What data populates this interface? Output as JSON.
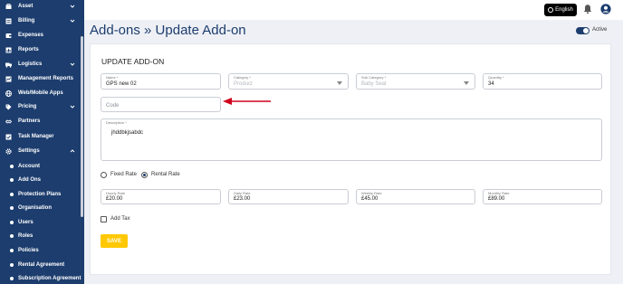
{
  "sidebar": {
    "items": [
      {
        "label": "Asset",
        "icon": "asset-icon",
        "chevron": "down"
      },
      {
        "label": "Billing",
        "icon": "billing-icon",
        "chevron": "down"
      },
      {
        "label": "Expenses",
        "icon": "expenses-icon"
      },
      {
        "label": "Reports",
        "icon": "reports-icon"
      },
      {
        "label": "Logistics",
        "icon": "logistics-icon",
        "chevron": "down"
      },
      {
        "label": "Management Reports",
        "icon": "management-reports-icon"
      },
      {
        "label": "Web/Mobile Apps",
        "icon": "globe-icon"
      },
      {
        "label": "Pricing",
        "icon": "tag-icon",
        "chevron": "down"
      },
      {
        "label": "Partners",
        "icon": "handshake-icon"
      },
      {
        "label": "Task Manager",
        "icon": "task-icon"
      },
      {
        "label": "Settings",
        "icon": "gear-icon",
        "chevron": "up"
      }
    ],
    "subitems": [
      {
        "label": "Account"
      },
      {
        "label": "Add Ons"
      },
      {
        "label": "Protection Plans"
      },
      {
        "label": "Organisation"
      },
      {
        "label": "Users"
      },
      {
        "label": "Roles"
      },
      {
        "label": "Policies"
      },
      {
        "label": "Rental Agreement"
      },
      {
        "label": "Subscription Agreement"
      }
    ]
  },
  "topbar": {
    "language": "English",
    "icons": [
      "bell-icon",
      "user-icon"
    ]
  },
  "page": {
    "title": "Add-ons » Update Add-on",
    "status_label": "Active",
    "status_on": true
  },
  "form": {
    "heading": "UPDATE ADD-ON",
    "name": {
      "label": "Name *",
      "value": "GPS new 02"
    },
    "category": {
      "label": "Category *",
      "value": "Product"
    },
    "subcategory": {
      "label": "Sub Category *",
      "value": "Baby Seat"
    },
    "quantity": {
      "label": "Quantity *",
      "value": "34"
    },
    "code": {
      "placeholder": "Code"
    },
    "description": {
      "label": "Description *",
      "value": "jhddbkjsabdc"
    },
    "rate_type": {
      "options": [
        "Fixed Rate",
        "Rental Rate"
      ],
      "selected": "Rental Rate"
    },
    "hourly": {
      "label": "Hourly Rate",
      "value": "£20.00"
    },
    "daily": {
      "label": "Daily Rate",
      "value": "£23.00"
    },
    "weekly": {
      "label": "Weekly Rate",
      "value": "£45.00"
    },
    "monthly": {
      "label": "Monthly Rate",
      "value": "£89.00"
    },
    "add_tax_label": "Add Tax",
    "save_label": "SAVE"
  },
  "colors": {
    "sidebar_bg": "#1c3d6e",
    "accent": "#ffc800",
    "arrow": "#d0021b"
  }
}
